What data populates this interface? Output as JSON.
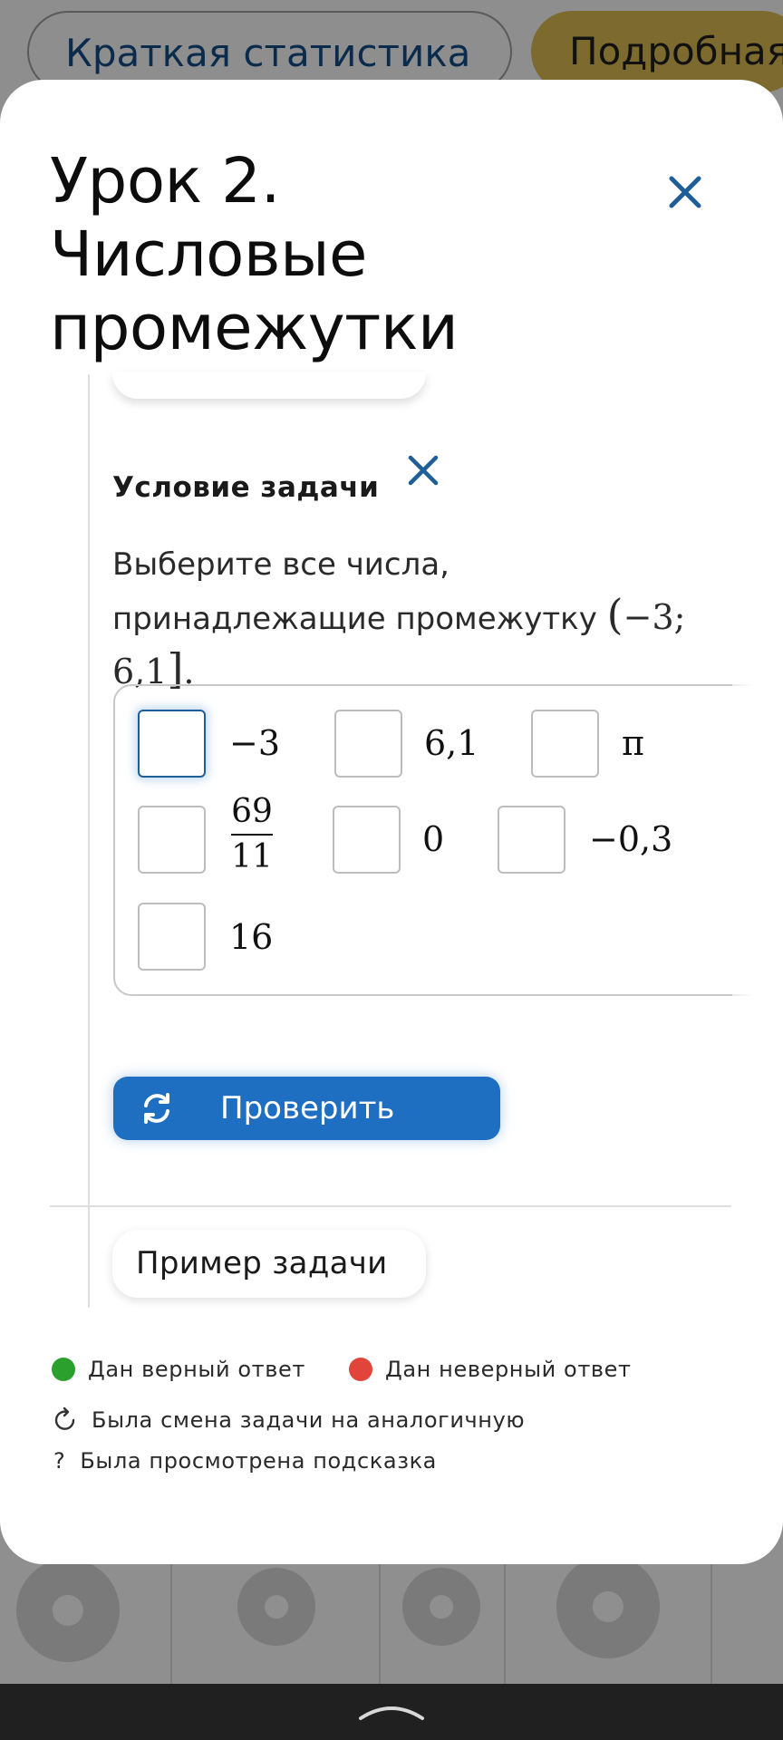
{
  "background": {
    "tabs": [
      {
        "label": "Краткая статистика"
      },
      {
        "label": "Подробная"
      }
    ]
  },
  "modal": {
    "title": "Урок 2. Числовые промежутки",
    "task": {
      "heading": "Условие задачи",
      "instruction": "Выберите все числа, принадлежащие промежутку",
      "interval_open": "(",
      "interval_body": "−3; 6,1",
      "interval_close": "]",
      "interval_end": ".",
      "options": [
        {
          "label": "−3"
        },
        {
          "label": "6,1"
        },
        {
          "label": "π"
        },
        {
          "numerator": "69",
          "denominator": "11"
        },
        {
          "label": "0"
        },
        {
          "label": "−0,3"
        },
        {
          "label": "16"
        }
      ],
      "check_label": "Проверить"
    },
    "example_label": "Пример задачи",
    "legend": {
      "correct": "Дан верный ответ",
      "wrong": "Дан неверный ответ",
      "replaced": "Была смена задачи на аналогичную",
      "hint_symbol": "?",
      "hint": "Была просмотрена подсказка"
    }
  },
  "colors": {
    "accent": "#1e6fc1",
    "close_icon": "#1e5f9a",
    "correct": "#2ca02c",
    "wrong": "#e0443a",
    "detail_tab": "#7d6a2e"
  }
}
